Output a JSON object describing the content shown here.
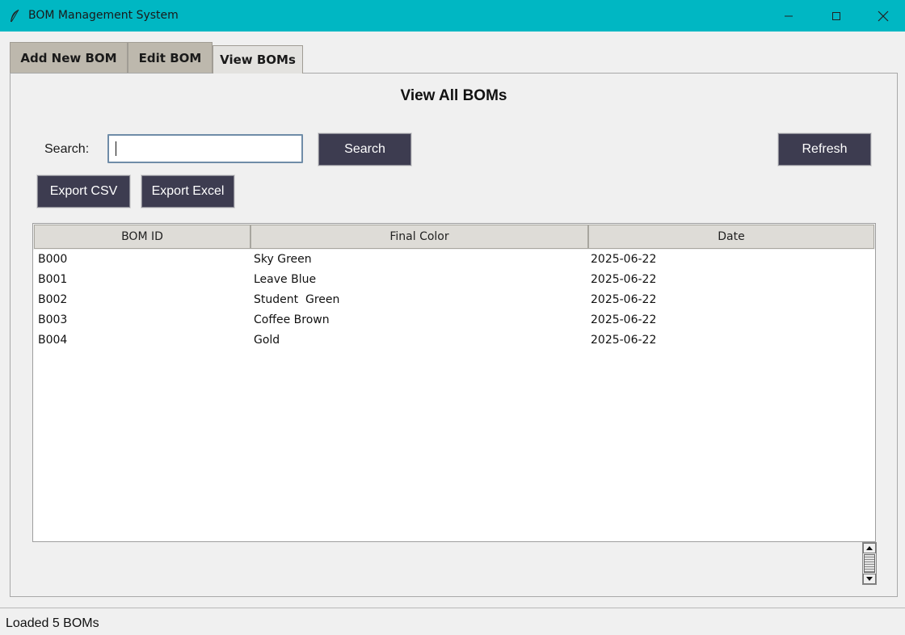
{
  "window": {
    "title": "BOM Management System",
    "accent_color": "#00b7c3"
  },
  "tabs": [
    {
      "label": "Add New BOM"
    },
    {
      "label": "Edit BOM"
    },
    {
      "label": "View BOMs",
      "active": true
    }
  ],
  "view": {
    "title": "View All BOMs",
    "search_label": "Search:",
    "search_value": "",
    "search_button": "Search",
    "refresh_button": "Refresh",
    "export_csv_button": "Export CSV",
    "export_excel_button": "Export Excel"
  },
  "table": {
    "columns": [
      "BOM ID",
      "Final Color",
      "Date"
    ],
    "rows": [
      {
        "id": "B000",
        "color": "Sky Green",
        "date": "2025-06-22"
      },
      {
        "id": "B001",
        "color": "Leave Blue",
        "date": "2025-06-22"
      },
      {
        "id": "B002",
        "color": "Student  Green",
        "date": "2025-06-22"
      },
      {
        "id": "B003",
        "color": "Coffee Brown",
        "date": "2025-06-22"
      },
      {
        "id": "B004",
        "color": "Gold",
        "date": "2025-06-22"
      }
    ]
  },
  "status": {
    "text": "Loaded 5 BOMs"
  },
  "icons": {
    "app": "feather-icon",
    "minimize": "minimize-icon",
    "maximize": "maximize-icon",
    "close": "close-icon"
  }
}
